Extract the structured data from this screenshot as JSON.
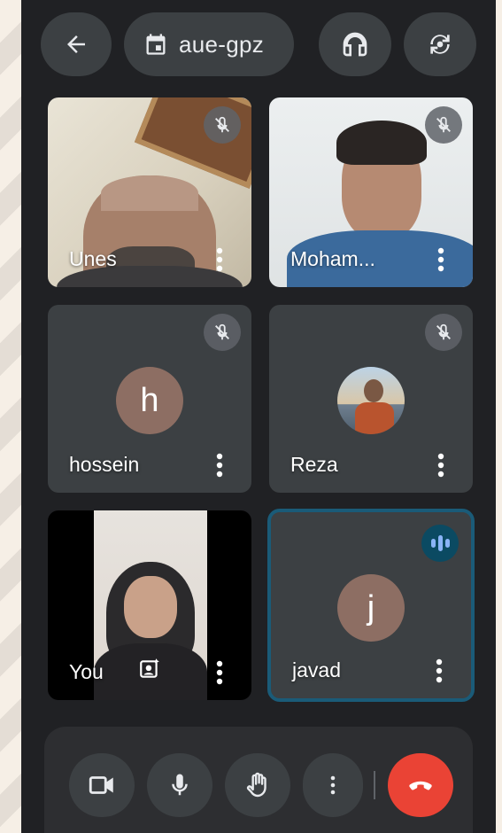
{
  "top_bar": {
    "back_icon": "arrow-left-icon",
    "meeting_icon": "calendar-icon",
    "meeting_code": "aue-gpz",
    "audio_icon": "headphones-icon",
    "switch_camera_icon": "switch-camera-icon"
  },
  "participants": [
    {
      "name": "Unes",
      "muted": true,
      "video": true
    },
    {
      "name": "Moham...",
      "muted": true,
      "video": true
    },
    {
      "name": "hossein",
      "muted": true,
      "video": false,
      "avatar_letter": "h",
      "avatar_color": "#8d6e63"
    },
    {
      "name": "Reza",
      "muted": true,
      "video": false,
      "avatar_photo": true
    },
    {
      "name": "You",
      "muted": false,
      "video": true,
      "self": true
    },
    {
      "name": "javad",
      "muted": false,
      "speaking": true,
      "video": false,
      "avatar_letter": "j",
      "avatar_color": "#8d6e63"
    }
  ],
  "controls": {
    "camera_icon": "video-camera-icon",
    "mic_icon": "microphone-icon",
    "raise_hand_icon": "raise-hand-icon",
    "more_icon": "more-vert-icon",
    "end_call_icon": "end-call-icon"
  },
  "colors": {
    "background": "#202124",
    "tile": "#3c4043",
    "speaking_border": "#1a5b78",
    "end_call": "#ea4335",
    "speaking_indicator": "#8ab4f8"
  }
}
